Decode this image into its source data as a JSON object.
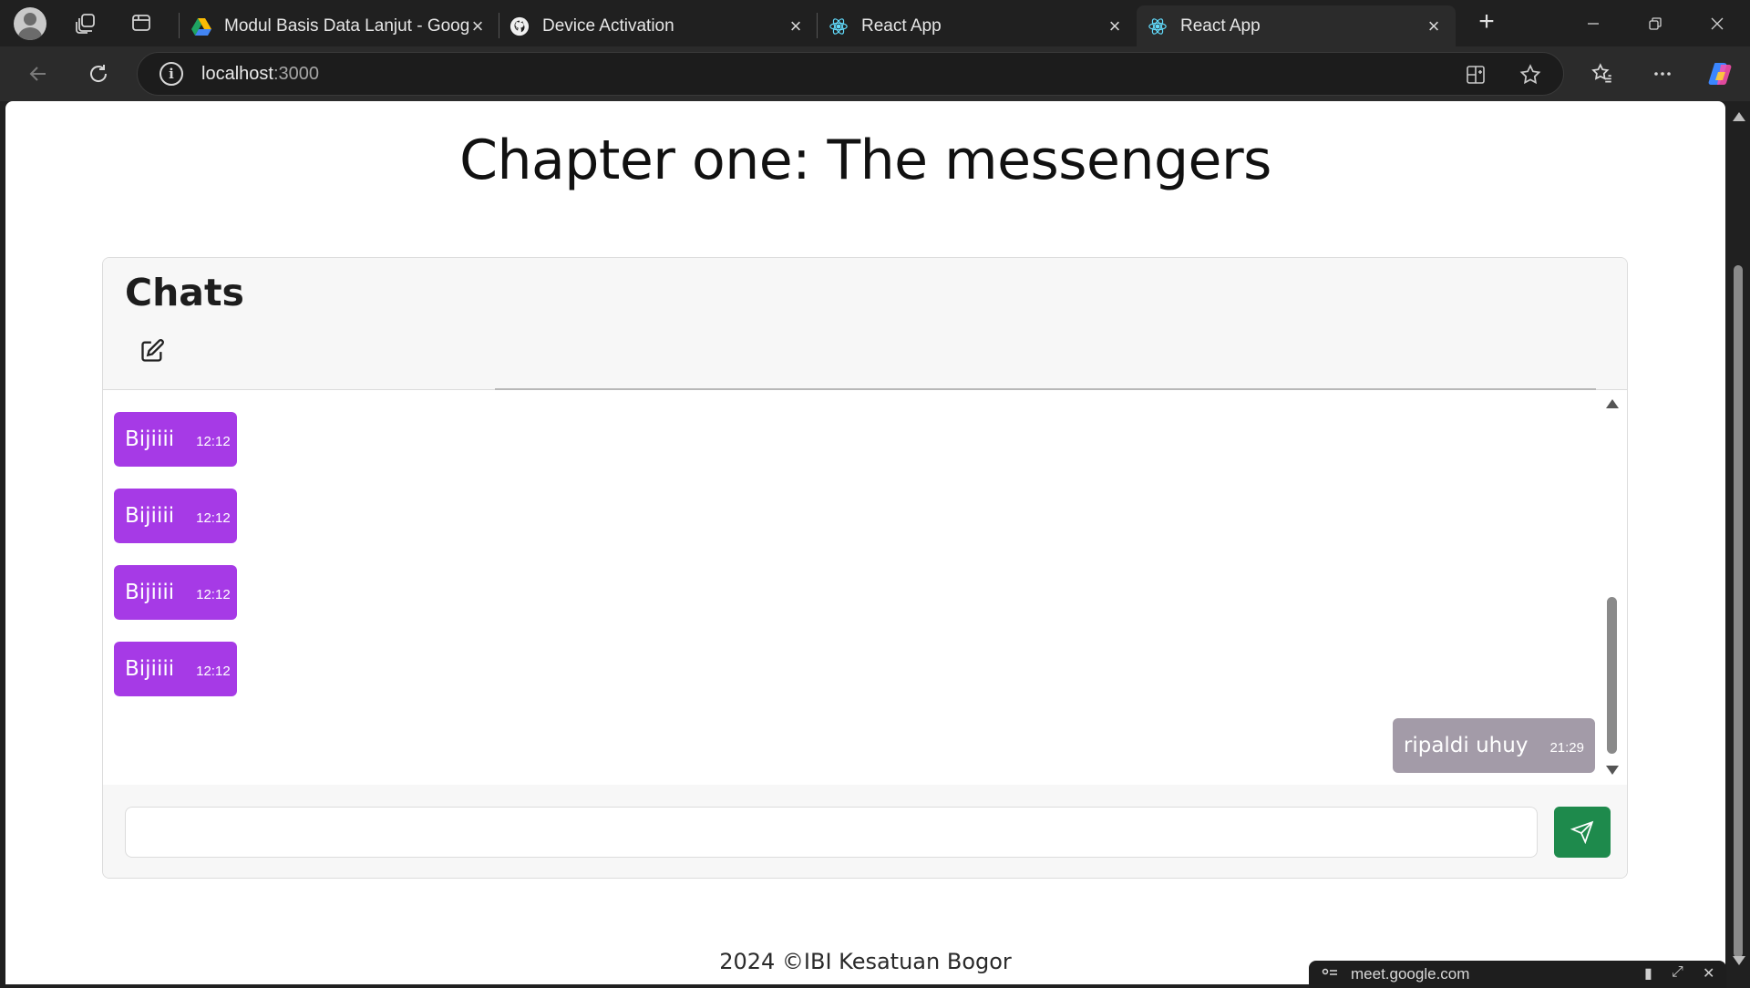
{
  "browser": {
    "tabs": [
      {
        "title": "Modul Basis Data Lanjut - Googl",
        "favicon": "google-drive-icon",
        "active": false
      },
      {
        "title": "Device Activation",
        "favicon": "github-icon",
        "active": false
      },
      {
        "title": "React App",
        "favicon": "react-icon",
        "active": false
      },
      {
        "title": "React App",
        "favicon": "react-icon",
        "active": true
      }
    ],
    "address": {
      "host": "localhost",
      "port": ":3000"
    },
    "popup": {
      "url": "meet.google.com"
    }
  },
  "page": {
    "title": "Chapter one: The messengers",
    "chat": {
      "heading": "Chats",
      "messages": [
        {
          "text": "Bijiiii",
          "time": "12:12",
          "from": "other"
        },
        {
          "text": "Bijiiii",
          "time": "12:12",
          "from": "other"
        },
        {
          "text": "Bijiiii",
          "time": "12:12",
          "from": "other"
        },
        {
          "text": "Bijiiii",
          "time": "12:12",
          "from": "other"
        },
        {
          "text": "ripaldi uhuy",
          "time": "21:29",
          "from": "me"
        }
      ],
      "input_placeholder": "",
      "input_value": ""
    },
    "footer": "2024 ©IBI Kesatuan Bogor"
  },
  "colors": {
    "other_bubble": "#a63ae6",
    "my_bubble": "#a39ba8",
    "send_button": "#1e8a4c"
  }
}
